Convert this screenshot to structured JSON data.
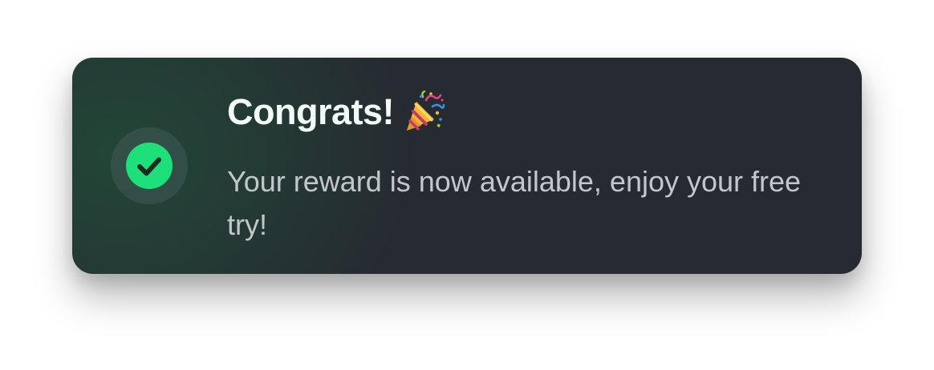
{
  "toast": {
    "title": "Congrats!",
    "message": "Your reward is now available, enjoy your free try!",
    "status_icon": "check-circle-icon",
    "title_emoji_icon": "party-popper-icon"
  },
  "colors": {
    "card_background": "#262b31",
    "card_glow": "#224838",
    "success_green": "#1ee07a",
    "check_mark": "#1c2a25",
    "ring": "#425a58",
    "title_text": "#f2fbf6",
    "message_text": "#c3c7cc"
  }
}
